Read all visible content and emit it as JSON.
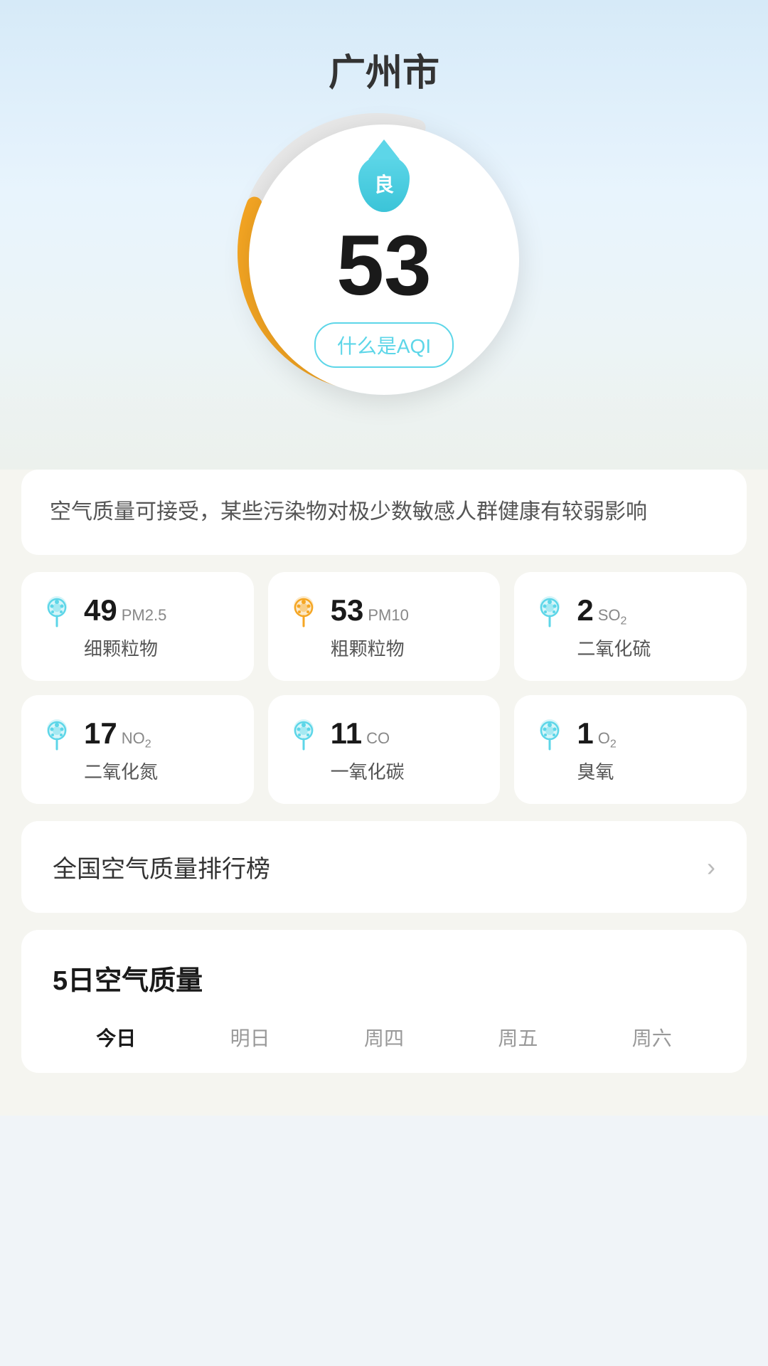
{
  "header": {
    "city": "广州市"
  },
  "aqi": {
    "value": "53",
    "quality_label": "良",
    "what_is_label": "什么是AQI",
    "description": "空气质量可接受，某些污染物对极少数敏感人群健康有较弱影响"
  },
  "pollutants": [
    {
      "value": "49",
      "unit": "PM2.5",
      "name": "细颗粒物",
      "color": "#5dd6e8",
      "orange": false
    },
    {
      "value": "53",
      "unit": "PM10",
      "name": "粗颗粒物",
      "color": "#f5a623",
      "orange": true
    },
    {
      "value": "2",
      "unit_main": "SO",
      "unit_sub": "2",
      "name": "二氧化硫",
      "color": "#5dd6e8",
      "orange": false
    },
    {
      "value": "17",
      "unit_main": "NO",
      "unit_sub": "2",
      "name": "二氧化氮",
      "color": "#5dd6e8",
      "orange": false
    },
    {
      "value": "11",
      "unit": "CO",
      "name": "一氧化碳",
      "color": "#5dd6e8",
      "orange": false
    },
    {
      "value": "1",
      "unit_main": "O",
      "unit_sub": "2",
      "name": "臭氧",
      "color": "#5dd6e8",
      "orange": false
    }
  ],
  "ranking": {
    "label": "全国空气质量排行榜"
  },
  "forecast": {
    "title": "5日空气质量",
    "days": [
      {
        "label": "今日",
        "today": true
      },
      {
        "label": "明日",
        "today": false
      },
      {
        "label": "周四",
        "today": false
      },
      {
        "label": "周五",
        "today": false
      },
      {
        "label": "周六",
        "today": false
      }
    ]
  }
}
